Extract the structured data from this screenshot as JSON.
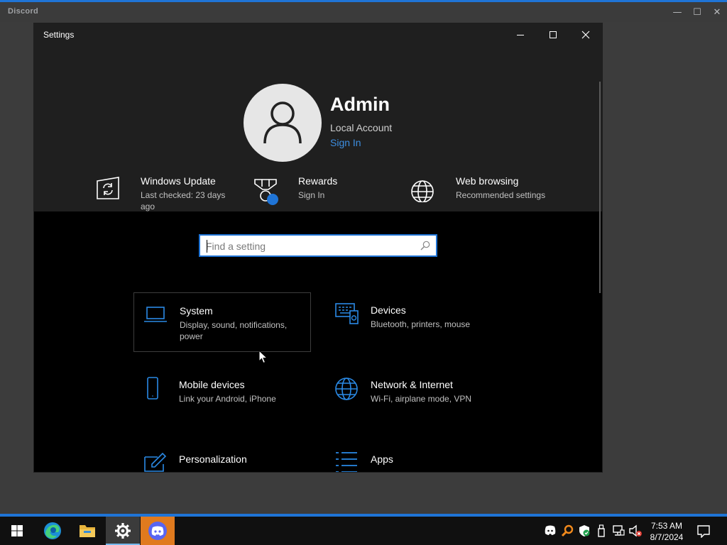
{
  "discord": {
    "title": "Discord",
    "controls": {
      "minimize": "—",
      "maximize": "☐",
      "close": "✕"
    }
  },
  "settings": {
    "title": "Settings",
    "user": {
      "name": "Admin",
      "account_type": "Local Account",
      "sign_in_label": "Sign In"
    },
    "quick_items": [
      {
        "title": "Windows Update",
        "subtitle": "Last checked: 23 days ago",
        "icon": "windows-update-icon"
      },
      {
        "title": "Rewards",
        "subtitle": "Sign In",
        "icon": "rewards-icon"
      },
      {
        "title": "Web browsing",
        "subtitle": "Recommended settings",
        "icon": "web-browsing-icon"
      }
    ],
    "search": {
      "placeholder": "Find a setting",
      "value": ""
    },
    "categories": [
      {
        "title": "System",
        "subtitle": "Display, sound, notifications, power",
        "icon": "laptop-icon",
        "selected": true
      },
      {
        "title": "Devices",
        "subtitle": "Bluetooth, printers, mouse",
        "icon": "devices-icon"
      },
      {
        "title": "Mobile devices",
        "subtitle": "Link your Android, iPhone",
        "icon": "phone-icon"
      },
      {
        "title": "Network & Internet",
        "subtitle": "Wi-Fi, airplane mode, VPN",
        "icon": "globe-icon"
      },
      {
        "title": "Personalization",
        "subtitle": "",
        "icon": "personalization-icon"
      },
      {
        "title": "Apps",
        "subtitle": "",
        "icon": "apps-icon"
      }
    ]
  },
  "taskbar": {
    "apps": [
      "start-icon",
      "edge-icon",
      "file-explorer-icon",
      "settings-icon",
      "discord-icon"
    ],
    "clock": {
      "time": "7:53 AM",
      "date": "8/7/2024"
    }
  },
  "colors": {
    "accent": "#1f74d6",
    "link": "#3d8ee0",
    "window_bg": "#000000",
    "header_bg": "#1f1f1f",
    "discord_active": "#e07a1e"
  }
}
